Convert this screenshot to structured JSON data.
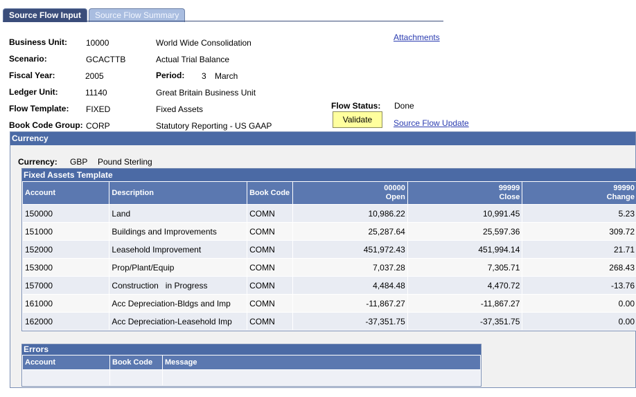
{
  "tabs": [
    {
      "label": "Source Flow Input",
      "active": true
    },
    {
      "label": "Source Flow Summary",
      "active": false
    }
  ],
  "header": {
    "business_unit": {
      "label": "Business Unit:",
      "code": "10000",
      "name": "World Wide Consolidation"
    },
    "scenario": {
      "label": "Scenario:",
      "code": "GCACTTB",
      "name": "Actual Trial Balance"
    },
    "fiscal_year": {
      "label": "Fiscal Year:",
      "value": "2005"
    },
    "period": {
      "label": "Period:",
      "number": "3",
      "name": "March"
    },
    "ledger_unit": {
      "label": "Ledger Unit:",
      "code": "11140",
      "name": "Great Britain Business Unit"
    },
    "flow_template": {
      "label": "Flow Template:",
      "code": "FIXED",
      "name": "Fixed Assets"
    },
    "book_code_group": {
      "label": "Book Code Group:",
      "code": "CORP",
      "name": "Statutory Reporting - US GAAP"
    },
    "flow_status": {
      "label": "Flow Status:",
      "value": "Done"
    },
    "attachments_link": "Attachments",
    "validate_button": "Validate",
    "source_flow_update_link": "Source Flow Update"
  },
  "currency_section": {
    "title": "Currency",
    "currency_label": "Currency:",
    "currency_code": "GBP",
    "currency_name": "Pound Sterling"
  },
  "template_grid": {
    "title": "Fixed Assets Template",
    "columns": {
      "account": "Account",
      "description": "Description",
      "book_code": "Book Code",
      "open_code": "00000",
      "open_label": "Open",
      "close_code": "99999",
      "close_label": "Close",
      "change_code": "99990",
      "change_label": "Change"
    },
    "rows": [
      {
        "account": "150000",
        "description": "Land",
        "book_code": "COMN",
        "open": "10,986.22",
        "close": "10,991.45",
        "change": "5.23"
      },
      {
        "account": "151000",
        "description": "Buildings and Improvements",
        "book_code": "COMN",
        "open": "25,287.64",
        "close": "25,597.36",
        "change": "309.72"
      },
      {
        "account": "152000",
        "description": "Leasehold Improvement",
        "book_code": "COMN",
        "open": "451,972.43",
        "close": "451,994.14",
        "change": "21.71"
      },
      {
        "account": "153000",
        "description": "Prop/Plant/Equip",
        "book_code": "COMN",
        "open": "7,037.28",
        "close": "7,305.71",
        "change": "268.43"
      },
      {
        "account": "157000",
        "description": "Construction   in Progress",
        "book_code": "COMN",
        "open": "4,484.48",
        "close": "4,470.72",
        "change": "-13.76"
      },
      {
        "account": "161000",
        "description": "Acc Depreciation-Bldgs and Imp",
        "book_code": "COMN",
        "open": "-11,867.27",
        "close": "-11,867.27",
        "change": "0.00"
      },
      {
        "account": "162000",
        "description": "Acc Depreciation-Leasehold Imp",
        "book_code": "COMN",
        "open": "-37,351.75",
        "close": "-37,351.75",
        "change": "0.00"
      }
    ]
  },
  "errors_grid": {
    "title": "Errors",
    "columns": {
      "account": "Account",
      "book_code": "Book Code",
      "message": "Message"
    }
  },
  "colors": {
    "header_blue": "#4b6aa5",
    "tab_active": "#3a4d7a",
    "validate_bg": "#ffff9e",
    "link": "#2a3bb0"
  }
}
